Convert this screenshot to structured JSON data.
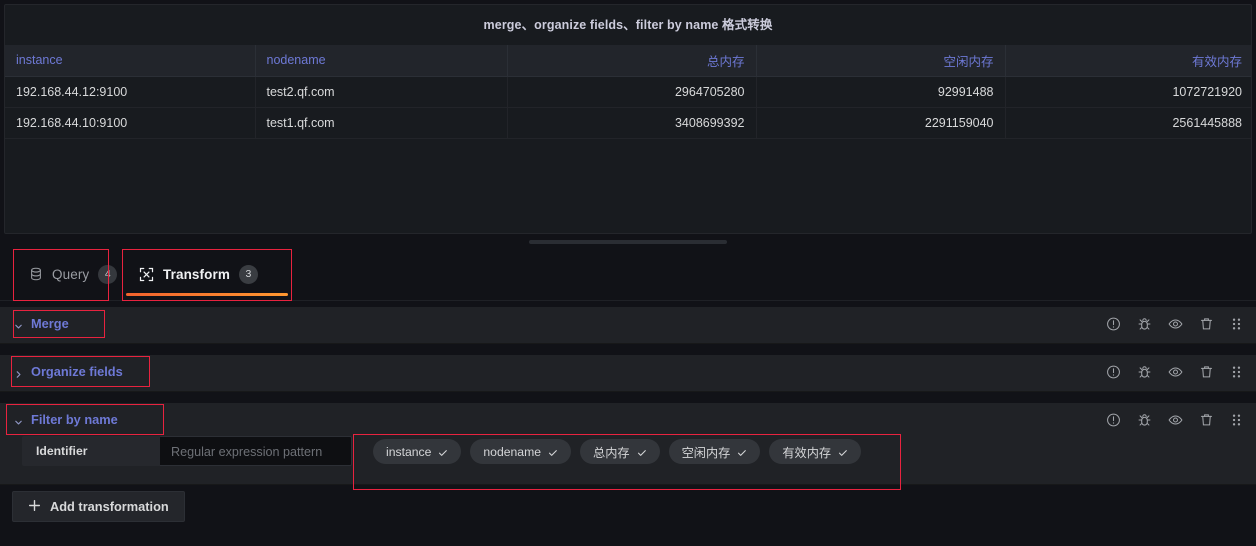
{
  "panel": {
    "title": "merge、organize fields、filter by name 格式转换",
    "table": {
      "columns": [
        {
          "label": "instance",
          "align": "left"
        },
        {
          "label": "nodename",
          "align": "left"
        },
        {
          "label": "总内存",
          "align": "right"
        },
        {
          "label": "空闲内存",
          "align": "right"
        },
        {
          "label": "有效内存",
          "align": "right"
        }
      ],
      "rows": [
        [
          "192.168.44.12:9100",
          "test2.qf.com",
          "2964705280",
          "92991488",
          "1072721920"
        ],
        [
          "192.168.44.10:9100",
          "test1.qf.com",
          "3408699392",
          "2291159040",
          "2561445888"
        ]
      ]
    }
  },
  "tabs": [
    {
      "label": "Query",
      "badge": "4",
      "icon": "database-icon",
      "active": false
    },
    {
      "label": "Transform",
      "badge": "3",
      "icon": "transform-icon",
      "active": true
    }
  ],
  "transformations": [
    {
      "name": "Merge",
      "expanded": true,
      "chevron": "chevron-down-icon"
    },
    {
      "name": "Organize fields",
      "expanded": false,
      "chevron": "chevron-right-icon"
    },
    {
      "name": "Filter by name",
      "expanded": true,
      "chevron": "chevron-down-icon"
    }
  ],
  "row_actions": [
    {
      "name": "info-icon"
    },
    {
      "name": "debug-bug-icon"
    },
    {
      "name": "eye-icon"
    },
    {
      "name": "trash-icon"
    },
    {
      "name": "drag-handle-icon"
    }
  ],
  "filter_by_name": {
    "identifier_label": "Identifier",
    "regex_placeholder": "Regular expression pattern",
    "regex_value": "",
    "fields": [
      {
        "label": "instance",
        "selected": true
      },
      {
        "label": "nodename",
        "selected": true
      },
      {
        "label": "总内存",
        "selected": true
      },
      {
        "label": "空闲内存",
        "selected": true
      },
      {
        "label": "有效内存",
        "selected": true
      }
    ]
  },
  "footer": {
    "add_transformation_label": "Add transformation",
    "add_icon": "plus-icon"
  },
  "colors": {
    "accent_blue": "#6e79d6",
    "accent_orange": "#ff9830",
    "annotation_red": "#e8233f",
    "panel_bg": "#181b1f",
    "page_bg": "#111217",
    "row_bg": "#202226"
  }
}
